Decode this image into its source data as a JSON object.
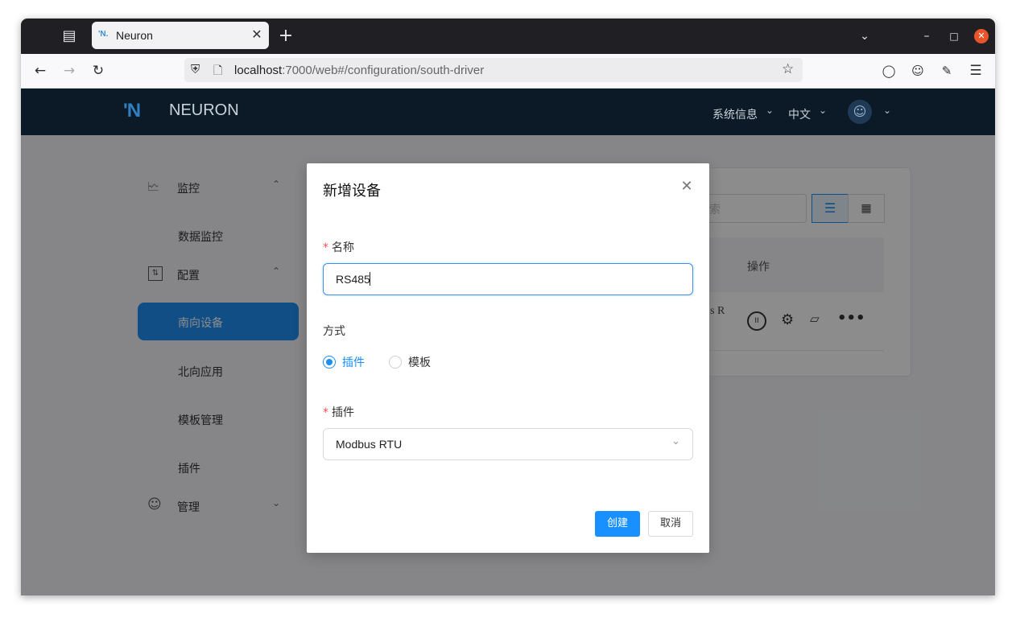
{
  "browser": {
    "tab_title": "Neuron",
    "tab_favicon": "'N.",
    "url_host": "localhost",
    "url_path": ":7000/web#/configuration/south-driver"
  },
  "header": {
    "logo_mark": "'N",
    "logo_text": "NEURON",
    "system_info": "系统信息",
    "language": "中文"
  },
  "sidebar": {
    "monitor": "监控",
    "data_monitor": "数据监控",
    "config": "配置",
    "south_devices": "南向设备",
    "north_apps": "北向应用",
    "template_mgmt": "模板管理",
    "plugins": "插件",
    "management": "管理"
  },
  "background_card": {
    "search_placeholder_fragment": "索",
    "actions_header": "操作",
    "row_text_fragment": "s R"
  },
  "modal": {
    "title": "新增设备",
    "name_label": "名称",
    "name_value": "RS485",
    "method_label": "方式",
    "radio_plugin": "插件",
    "radio_template": "模板",
    "plugin_label": "插件",
    "plugin_value": "Modbus RTU",
    "create_button": "创建",
    "cancel_button": "取消"
  },
  "colors": {
    "accent": "#1890ff",
    "header_bg": "#0b1a26",
    "required": "#ff4d4f"
  }
}
